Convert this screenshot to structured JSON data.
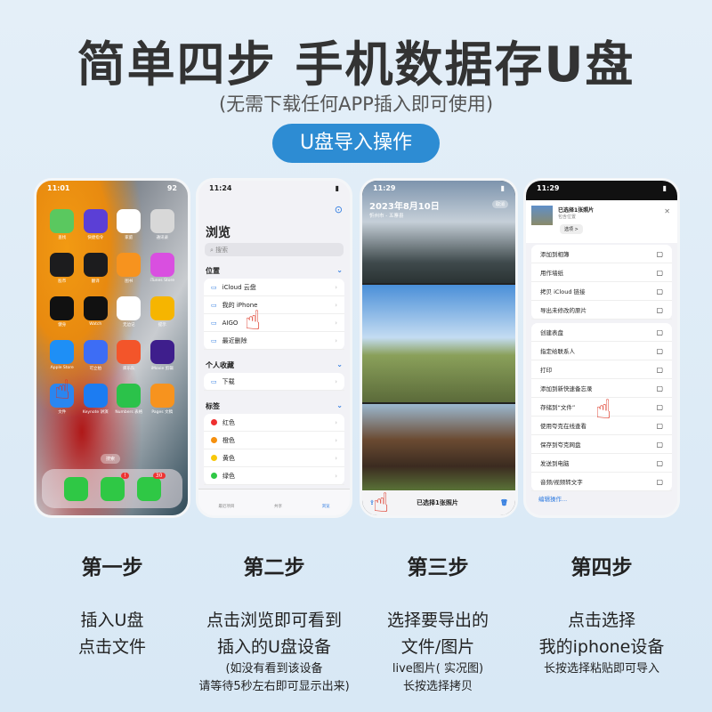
{
  "header": {
    "title": "简单四步 手机数据存U盘",
    "subtitle": "(无需下载任何APP插入即可使用)",
    "button": "U盘导入操作"
  },
  "phone1": {
    "time": "11:01",
    "battery": "92",
    "apps": [
      {
        "label": "查找",
        "color": "#5ac85f"
      },
      {
        "label": "快捷指令",
        "color": "#5b3fd6"
      },
      {
        "label": "家庭",
        "color": "#ffffff"
      },
      {
        "label": "通讯录",
        "color": "#d8d8d8"
      },
      {
        "label": "股市",
        "color": "#1c1c1e"
      },
      {
        "label": "翻译",
        "color": "#1c1c1e"
      },
      {
        "label": "图书",
        "color": "#f7931e"
      },
      {
        "label": "iTunes Store",
        "color": "#d94fe0"
      },
      {
        "label": "健身",
        "color": "#111111"
      },
      {
        "label": "Watch",
        "color": "#111111"
      },
      {
        "label": "无边记",
        "color": "#ffffff"
      },
      {
        "label": "提示",
        "color": "#f6b500"
      },
      {
        "label": "Apple Store",
        "color": "#1e8ff6"
      },
      {
        "label": "可立拍",
        "color": "#3d6df5"
      },
      {
        "label": "库乐队",
        "color": "#f3552a"
      },
      {
        "label": "iMovie 剪辑",
        "color": "#3e1e8c"
      },
      {
        "label": "文件",
        "color": "#2a86f0"
      },
      {
        "label": "Keynote 讲演",
        "color": "#1c7cf2"
      },
      {
        "label": "Numbers 表格",
        "color": "#2bc24a"
      },
      {
        "label": "Pages 文稿",
        "color": "#f7931e"
      }
    ],
    "search": "搜索",
    "dock": [
      {
        "name": "phone",
        "badge": ""
      },
      {
        "name": "messages",
        "badge": "!"
      },
      {
        "name": "wechat",
        "badge": "30"
      }
    ]
  },
  "phone2": {
    "time": "11:24",
    "title": "浏览",
    "search_placeholder": "搜索",
    "sections": [
      {
        "title": "位置",
        "items": [
          "iCloud 云盘",
          "我的 iPhone",
          "AIGO",
          "最近删除"
        ]
      },
      {
        "title": "个人收藏",
        "items": [
          "下载"
        ]
      },
      {
        "title": "标签",
        "items": [
          "红色",
          "橙色",
          "黄色",
          "绿色"
        ]
      }
    ],
    "tag_colors": [
      "#ee3030",
      "#f5900f",
      "#f8c80a",
      "#2fc845"
    ],
    "tabs": [
      "最近项目",
      "共享",
      "浏览"
    ]
  },
  "phone3": {
    "time": "11:29",
    "date": "2023年8月10日",
    "location": "忻州市 - 五寨县",
    "cancel": "取消",
    "bottom": "已选择1张照片"
  },
  "phone4": {
    "time": "11:29",
    "selected": "已选择1张照片",
    "location": "包含位置",
    "options": "选项 >",
    "group1": [
      "添加到相簿",
      "用作墙纸",
      "拷贝 iCloud 链接",
      "导出未修改的原片"
    ],
    "group2": [
      "创建表盘",
      "指定给联系人",
      "打印",
      "添加到新快速备忘录",
      "存储到“文件”",
      "使用夸克在线查看",
      "保存到夸克网盘",
      "发送到电脑",
      "音频/视频转文字"
    ],
    "edit": "编辑操作..."
  },
  "steps": [
    {
      "title": "第一步",
      "lines": [
        "插入U盘",
        "点击文件"
      ],
      "notes": []
    },
    {
      "title": "第二步",
      "lines": [
        "点击浏览即可看到",
        "插入的U盘设备"
      ],
      "notes": [
        "(如没有看到该设备",
        "请等待5秒左右即可显示出来)"
      ]
    },
    {
      "title": "第三步",
      "lines": [
        "选择要导出的",
        "文件/图片"
      ],
      "notes": [
        "live图片( 实况图)",
        "长按选择拷贝"
      ]
    },
    {
      "title": "第四步",
      "lines": [
        "点击选择",
        "我的iphone设备"
      ],
      "notes": [
        "长按选择粘贴即可导入"
      ]
    }
  ],
  "colors": {
    "accent": "#2d8cd3",
    "title": "#333333",
    "hand": "#d32f2f"
  }
}
